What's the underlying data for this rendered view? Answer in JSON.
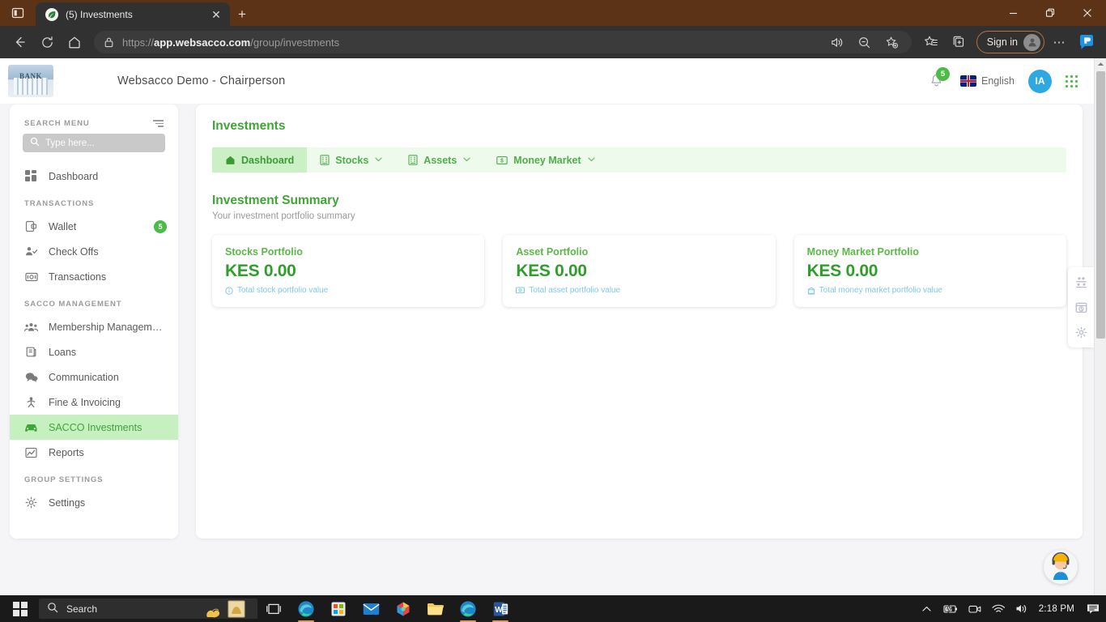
{
  "browser": {
    "tab": {
      "title": "(5) Investments",
      "favicon": "leaf-favicon",
      "close_label": "✕"
    },
    "newtab_label": "+",
    "window": {
      "minimize": "—",
      "restore": "❐",
      "close": "✕"
    },
    "nav": {
      "back": "←",
      "reload": "⟳",
      "home": "⌂"
    },
    "address": {
      "scheme": "https://",
      "host": "app.websacco.com",
      "path": "/group/investments",
      "full_url": "https://app.websacco.com/group/investments",
      "lock_icon": "lock-icon"
    },
    "actions": {
      "read_aloud": "read-aloud-icon",
      "zoom_out": "zoom-out-icon",
      "add_favorite": "add-favorite-icon",
      "favorites": "favorites-icon",
      "collections": "collections-icon",
      "signin_label": "Sign in",
      "settings_more": "⋯",
      "copilot": "copilot-icon"
    }
  },
  "app": {
    "logo_alt": "bank-logo",
    "title": "Websacco Demo - Chairperson",
    "header": {
      "notifications": {
        "icon": "bell-icon",
        "count": "5"
      },
      "language": {
        "flag": "uk-flag-icon",
        "label": "English"
      },
      "avatar_initials": "IA",
      "apps_grid": "apps-grid-icon"
    }
  },
  "sidebar": {
    "search_label": "SEARCH MENU",
    "filter_icon": "filter-icon",
    "search_placeholder": "Type here...",
    "search_value": "",
    "groups": [
      {
        "label": "",
        "items": [
          {
            "label": "Dashboard",
            "icon": "dashboard-icon",
            "active": false,
            "badge": ""
          }
        ]
      },
      {
        "label": "TRANSACTIONS",
        "items": [
          {
            "label": "Wallet",
            "icon": "wallet-icon",
            "active": false,
            "badge": "5"
          },
          {
            "label": "Check Offs",
            "icon": "check-offs-icon",
            "active": false,
            "badge": ""
          },
          {
            "label": "Transactions",
            "icon": "transactions-icon",
            "active": false,
            "badge": ""
          }
        ]
      },
      {
        "label": "SACCO MANAGEMENT",
        "items": [
          {
            "label": "Membership Managem…",
            "icon": "members-icon",
            "active": false,
            "badge": ""
          },
          {
            "label": "Loans",
            "icon": "loans-icon",
            "active": false,
            "badge": ""
          },
          {
            "label": "Communication",
            "icon": "communication-icon",
            "active": false,
            "badge": ""
          },
          {
            "label": "Fine & Invoicing",
            "icon": "fine-invoicing-icon",
            "active": false,
            "badge": ""
          },
          {
            "label": "SACCO Investments",
            "icon": "investments-icon",
            "active": true,
            "badge": ""
          },
          {
            "label": "Reports",
            "icon": "reports-icon",
            "active": false,
            "badge": ""
          }
        ]
      },
      {
        "label": "GROUP SETTINGS",
        "items": [
          {
            "label": "Settings",
            "icon": "gear-icon",
            "active": false,
            "badge": ""
          }
        ]
      }
    ]
  },
  "main": {
    "page_title": "Investments",
    "tabs": [
      {
        "label": "Dashboard",
        "icon": "home-icon",
        "active": true,
        "has_chevron": false
      },
      {
        "label": "Stocks",
        "icon": "building-icon",
        "active": false,
        "has_chevron": true
      },
      {
        "label": "Assets",
        "icon": "building-icon",
        "active": false,
        "has_chevron": true
      },
      {
        "label": "Money Market",
        "icon": "cash-icon",
        "active": false,
        "has_chevron": true
      }
    ],
    "summary": {
      "title": "Investment Summary",
      "subtitle": "Your investment portfolio summary"
    },
    "cards": [
      {
        "title": "Stocks Portfolio",
        "value": "KES 0.00",
        "footer": "Total stock portfolio value",
        "footer_icon": "info-circle-icon"
      },
      {
        "title": "Asset Portfolio",
        "value": "KES 0.00",
        "footer": "Total asset portfolio value",
        "footer_icon": "banknote-icon"
      },
      {
        "title": "Money Market Portfolio",
        "value": "KES 0.00",
        "footer": "Total money market portfolio value",
        "footer_icon": "bank-icon"
      }
    ]
  },
  "toolrail": [
    {
      "icon": "people-settings-icon"
    },
    {
      "icon": "calendar-clock-icon"
    },
    {
      "icon": "gear-icon"
    }
  ],
  "chat_widget": {
    "icon": "support-agent-icon"
  },
  "taskbar": {
    "start": "windows-start-icon",
    "search_placeholder": "Search",
    "task_view": "task-view-icon",
    "apps": [
      {
        "icon": "edge-icon",
        "running": true
      },
      {
        "icon": "microsoft-store-icon",
        "running": false
      },
      {
        "icon": "mail-icon",
        "running": false
      },
      {
        "icon": "paint3d-icon",
        "running": false
      },
      {
        "icon": "file-explorer-icon",
        "running": false
      },
      {
        "icon": "edge-icon",
        "running": true
      },
      {
        "icon": "word-icon",
        "running": true
      }
    ],
    "tray": {
      "overflow": "chevron-up-icon",
      "battery": "battery-charging-icon",
      "meet_now": "meet-now-icon",
      "network": "wifi-icon",
      "volume": "volume-icon",
      "clock": "2:18 PM",
      "notifications": "notification-center-icon"
    }
  },
  "colors": {
    "brand_green": "#3fa535",
    "accent_green": "#4cbb47",
    "active_bg": "#c7f0c0",
    "tabs_bg": "#eefaec",
    "avatar_blue": "#2ea8e0",
    "footer_blue": "#7ec9e8",
    "titlebar_brown": "#5d3318"
  }
}
